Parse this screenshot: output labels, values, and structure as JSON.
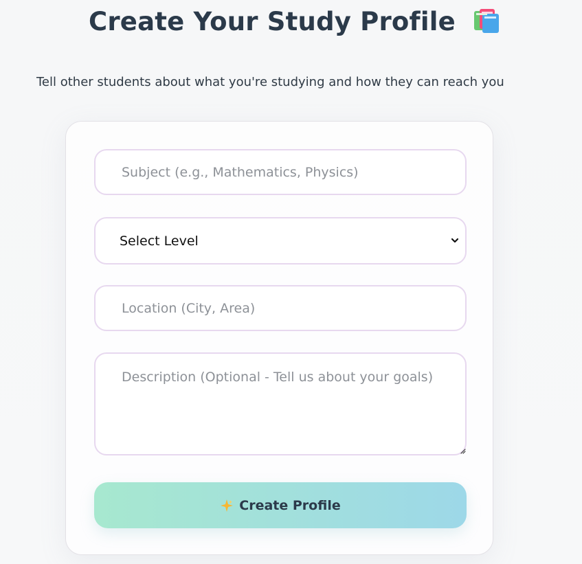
{
  "header": {
    "title": "Create Your Study Profile",
    "subtitle": "Tell other students about what you're studying and how they can reach you",
    "title_icon": "books-icon"
  },
  "form": {
    "subject_placeholder": "Subject (e.g., Mathematics, Physics)",
    "level_value": "Select Level",
    "location_placeholder": "Location (City, Area)",
    "description_placeholder": "Description (Optional - Tell us about your goals)",
    "submit_label": "Create Profile",
    "submit_icon": "sparkles-icon"
  },
  "colors": {
    "title": "#2b3a4a",
    "field_border": "#e7d8ef",
    "button_gradient_start": "#a7e8cf",
    "button_gradient_end": "#9dd8e8"
  }
}
